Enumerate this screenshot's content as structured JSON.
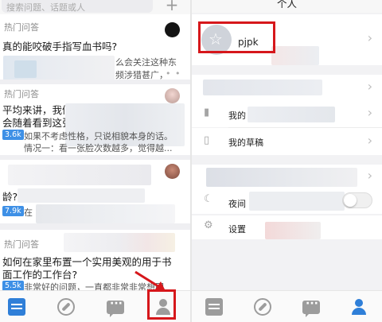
{
  "feed": {
    "search_placeholder": "搜索问题、话题或人",
    "add_icon": "plus-icon",
    "cards": [
      {
        "title": "真的能咬破手指写血书吗?",
        "body_line1": "么会关注这种东",
        "body_line2": "频涉猎甚广，",
        "more": "• • •"
      },
      {
        "tag": "热门问答",
        "title_line1": "平均来讲，我们到",
        "title_line2": "会随着看到这张",
        "badge": "3.6k",
        "body_line1": "如果不考虑性格，只说相貌本身的话。",
        "body_line2": "情况一：看一张脸次数越多，觉得越..."
      },
      {
        "title_part": "龄?",
        "badge": "7.9k",
        "body": "在"
      },
      {
        "tag": "热门问答",
        "title_line1": "如何在家里布置一个实用美观的用于书",
        "title_line2": "面工作的工作台?",
        "badge": "5.5k",
        "body": "非常好的问题，一直都非常非常想回"
      }
    ],
    "first_tag": "热门问答",
    "tabs": [
      "home-list-icon",
      "compass-icon",
      "chat-icon",
      "user-icon"
    ]
  },
  "profile": {
    "title": "个人",
    "username": "pjpk",
    "rows": [
      {
        "label": "我的",
        "icon": "bookmark-icon"
      },
      {
        "label": "我的草稿",
        "icon": "draft-icon"
      }
    ],
    "night_mode_label": "夜间",
    "settings_label": "设置",
    "tabs": [
      "home-list-icon",
      "compass-icon",
      "chat-icon",
      "user-icon"
    ]
  },
  "colors": {
    "accent": "#2f7fd8",
    "highlight": "#d6171b",
    "badge": "#3e90e6"
  }
}
